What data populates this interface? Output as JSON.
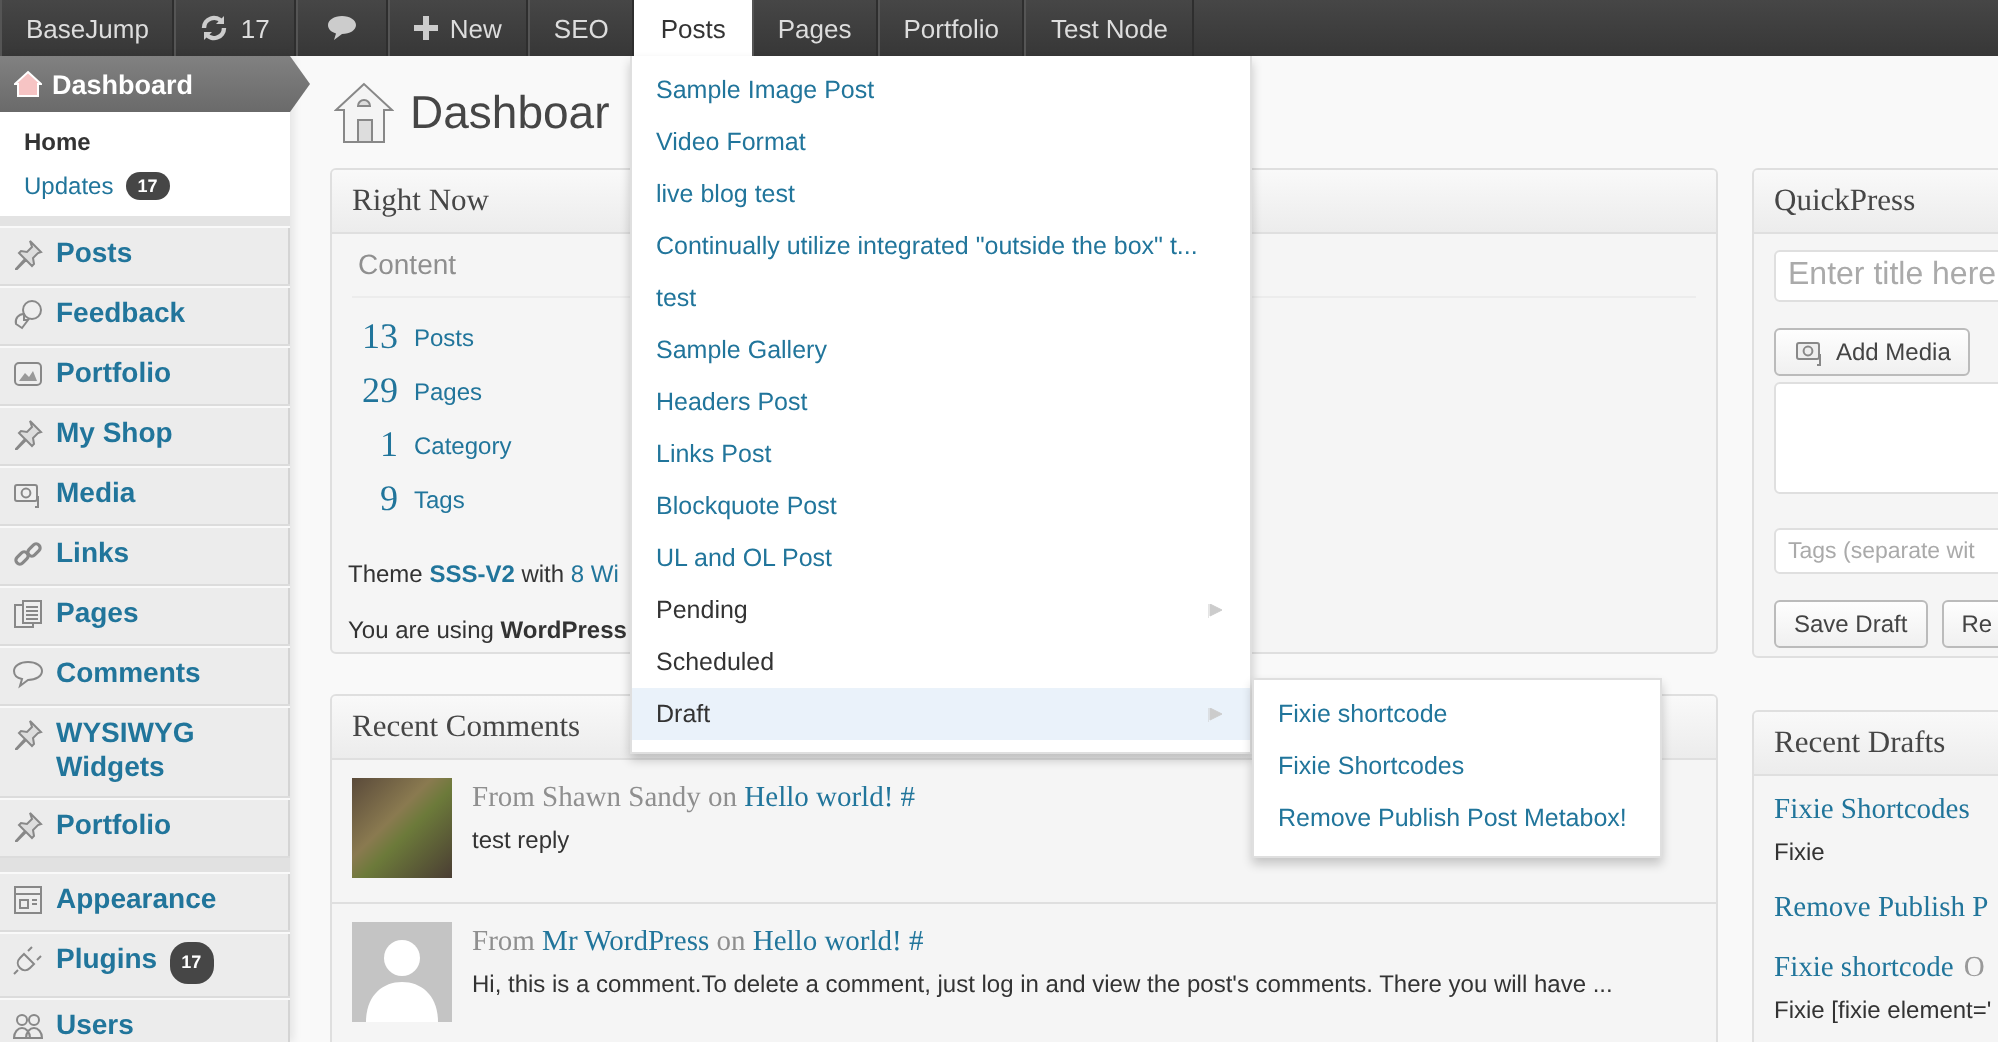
{
  "admin_bar": {
    "items": [
      {
        "kind": "text",
        "label": "BaseJump",
        "selected": false
      },
      {
        "kind": "updates",
        "label": "17",
        "selected": false
      },
      {
        "kind": "comments",
        "selected": false
      },
      {
        "kind": "new",
        "label": "New",
        "selected": false
      },
      {
        "kind": "text",
        "label": "SEO",
        "selected": false
      },
      {
        "kind": "text",
        "label": "Posts",
        "selected": true
      },
      {
        "kind": "text",
        "label": "Pages",
        "selected": false
      },
      {
        "kind": "text",
        "label": "Portfolio",
        "selected": false
      },
      {
        "kind": "text",
        "label": "Test Node",
        "selected": false
      }
    ]
  },
  "sidebar": {
    "header": {
      "label": "Dashboard",
      "selected": true
    },
    "submenu": [
      {
        "label": "Home",
        "selected": true
      },
      {
        "label": "Updates",
        "badge": "17",
        "selected": false
      }
    ],
    "groups": [
      [
        {
          "kind": "pin",
          "label": "Posts"
        },
        {
          "kind": "feedback",
          "label": "Feedback"
        },
        {
          "kind": "image",
          "label": "Portfolio"
        },
        {
          "kind": "pin",
          "label": "My Shop"
        },
        {
          "kind": "media",
          "label": "Media"
        },
        {
          "kind": "links",
          "label": "Links"
        },
        {
          "kind": "pages",
          "label": "Pages"
        },
        {
          "kind": "comments",
          "label": "Comments"
        },
        {
          "kind": "pin",
          "label": "WYSIWYG Widgets"
        },
        {
          "kind": "pin",
          "label": "Portfolio"
        }
      ],
      [
        {
          "kind": "appearance",
          "label": "Appearance"
        },
        {
          "kind": "plugins",
          "label": "Plugins",
          "badge": "17"
        },
        {
          "kind": "users",
          "label": "Users"
        }
      ]
    ]
  },
  "page_title": "Dashboar",
  "right_now": {
    "title": "Right Now",
    "section": "Content",
    "rows": [
      {
        "count": "13",
        "label": "Posts"
      },
      {
        "count": "29",
        "label": "Pages"
      },
      {
        "count": "1",
        "label": "Category"
      },
      {
        "count": "9",
        "label": "Tags"
      }
    ],
    "theme_line": {
      "prefix": "Theme",
      "theme": "SSS-V2",
      "middle": "with",
      "widgets": "8 Wi"
    },
    "version_line": "You are using **WordPress**"
  },
  "recent_comments": {
    "title": "Recent Comments",
    "items": [
      {
        "kind": "photo",
        "prefix": "From",
        "author": "Shawn Sandy",
        "author_link": false,
        "joiner": "on",
        "post": "Hello world! #",
        "text": "test reply"
      },
      {
        "kind": "silhouette",
        "prefix": "From",
        "author": "Mr WordPress",
        "author_link": true,
        "joiner": "on",
        "post": "Hello world! #",
        "text": "Hi, this is a comment.To delete a comment, just log in and view the post's comments. There you will have ..."
      }
    ]
  },
  "quickpress": {
    "title": "QuickPress",
    "title_placeholder": "Enter title here",
    "add_media": "Add Media",
    "tags_placeholder": "Tags (separate wit",
    "buttons": [
      "Save Draft",
      "Re"
    ]
  },
  "recent_drafts": {
    "title": "Recent Drafts",
    "items": [
      {
        "title": "Fixie Shortcodes",
        "excerpt": "Fixie"
      },
      {
        "title": "Remove Publish P"
      },
      {
        "title": "Fixie shortcode",
        "date": "O",
        "excerpt": "Fixie [fixie element='"
      }
    ]
  },
  "posts_menu": {
    "items": [
      {
        "kind": "post",
        "label": "Sample Image Post",
        "has_submenu": false,
        "selected": false
      },
      {
        "kind": "post",
        "label": "Video Format",
        "has_submenu": false,
        "selected": false
      },
      {
        "kind": "post",
        "label": "live blog test",
        "has_submenu": false,
        "selected": false
      },
      {
        "kind": "post",
        "label": "Continually utilize integrated \"outside the box\" t...",
        "has_submenu": false,
        "selected": false
      },
      {
        "kind": "post",
        "label": "test",
        "has_submenu": false,
        "selected": false
      },
      {
        "kind": "post",
        "label": "Sample Gallery",
        "has_submenu": false,
        "selected": false
      },
      {
        "kind": "post",
        "label": "Headers Post",
        "has_submenu": false,
        "selected": false
      },
      {
        "kind": "post",
        "label": "Links Post",
        "has_submenu": false,
        "selected": false
      },
      {
        "kind": "post",
        "label": "Blockquote Post",
        "has_submenu": false,
        "selected": false
      },
      {
        "kind": "post",
        "label": "UL and OL Post",
        "has_submenu": false,
        "selected": false
      },
      {
        "kind": "status",
        "label": "Pending",
        "has_submenu": true,
        "selected": false
      },
      {
        "kind": "status",
        "label": "Scheduled",
        "has_submenu": false,
        "selected": false
      },
      {
        "kind": "status",
        "label": "Draft",
        "has_submenu": true,
        "selected": true
      }
    ]
  },
  "draft_submenu": {
    "items": [
      "Fixie shortcode",
      "Fixie Shortcodes",
      "Remove Publish Post Metabox!"
    ]
  }
}
